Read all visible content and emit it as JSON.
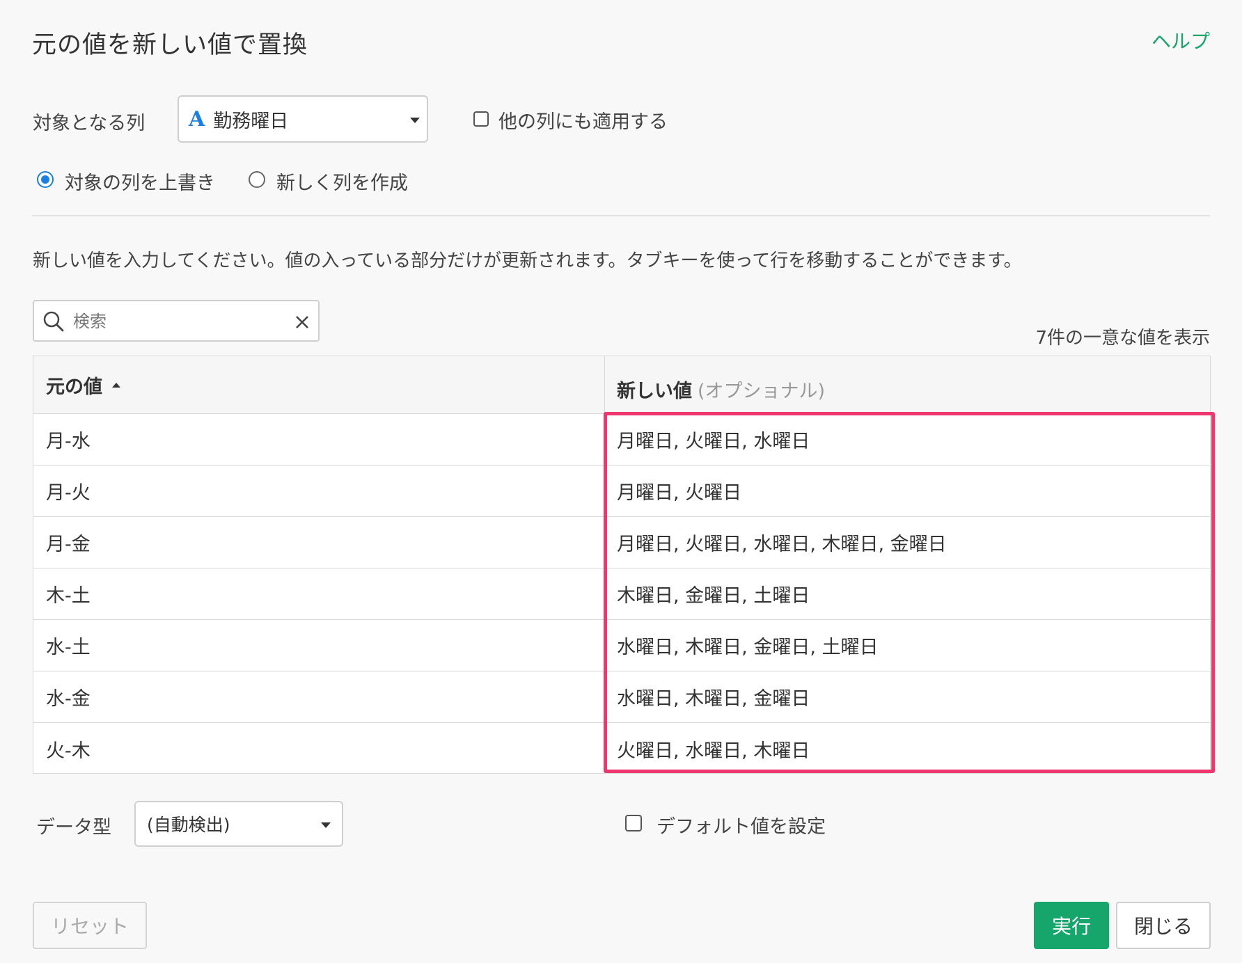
{
  "dialog": {
    "title": "元の値を新しい値で置換",
    "help": "ヘルプ"
  },
  "target": {
    "label": "対象となる列",
    "type_icon": "A",
    "column": "勤務曜日",
    "apply_other": "他の列にも適用する"
  },
  "mode": {
    "overwrite": "対象の列を上書き",
    "new_column": "新しく列を作成",
    "selected": "overwrite"
  },
  "instruction": "新しい値を入力してください。値の入っている部分だけが更新されます。タブキーを使って行を移動することができます。",
  "search": {
    "placeholder": "検索"
  },
  "count_text": "7件の一意な値を表示",
  "table": {
    "col1": "元の値",
    "col2": "新しい値",
    "col2_hint": "(オプショナル)",
    "rows": [
      {
        "orig": "月-水",
        "new": "月曜日, 火曜日, 水曜日"
      },
      {
        "orig": "月-火",
        "new": "月曜日, 火曜日"
      },
      {
        "orig": "月-金",
        "new": "月曜日, 火曜日, 水曜日, 木曜日, 金曜日"
      },
      {
        "orig": "木-土",
        "new": "木曜日, 金曜日, 土曜日"
      },
      {
        "orig": "水-土",
        "new": "水曜日, 木曜日, 金曜日, 土曜日"
      },
      {
        "orig": "水-金",
        "new": "水曜日, 木曜日, 金曜日"
      },
      {
        "orig": "火-木",
        "new": "火曜日, 水曜日, 木曜日"
      }
    ]
  },
  "datatype": {
    "label": "データ型",
    "value": "(自動検出)"
  },
  "default_value": {
    "label": "デフォルト値を設定"
  },
  "footer": {
    "reset": "リセット",
    "run": "実行",
    "close": "閉じる"
  },
  "colors": {
    "accent": "#16a56a",
    "radio": "#1a7fe0",
    "highlight": "#f0366f",
    "type_icon": "#1a7fe0"
  }
}
